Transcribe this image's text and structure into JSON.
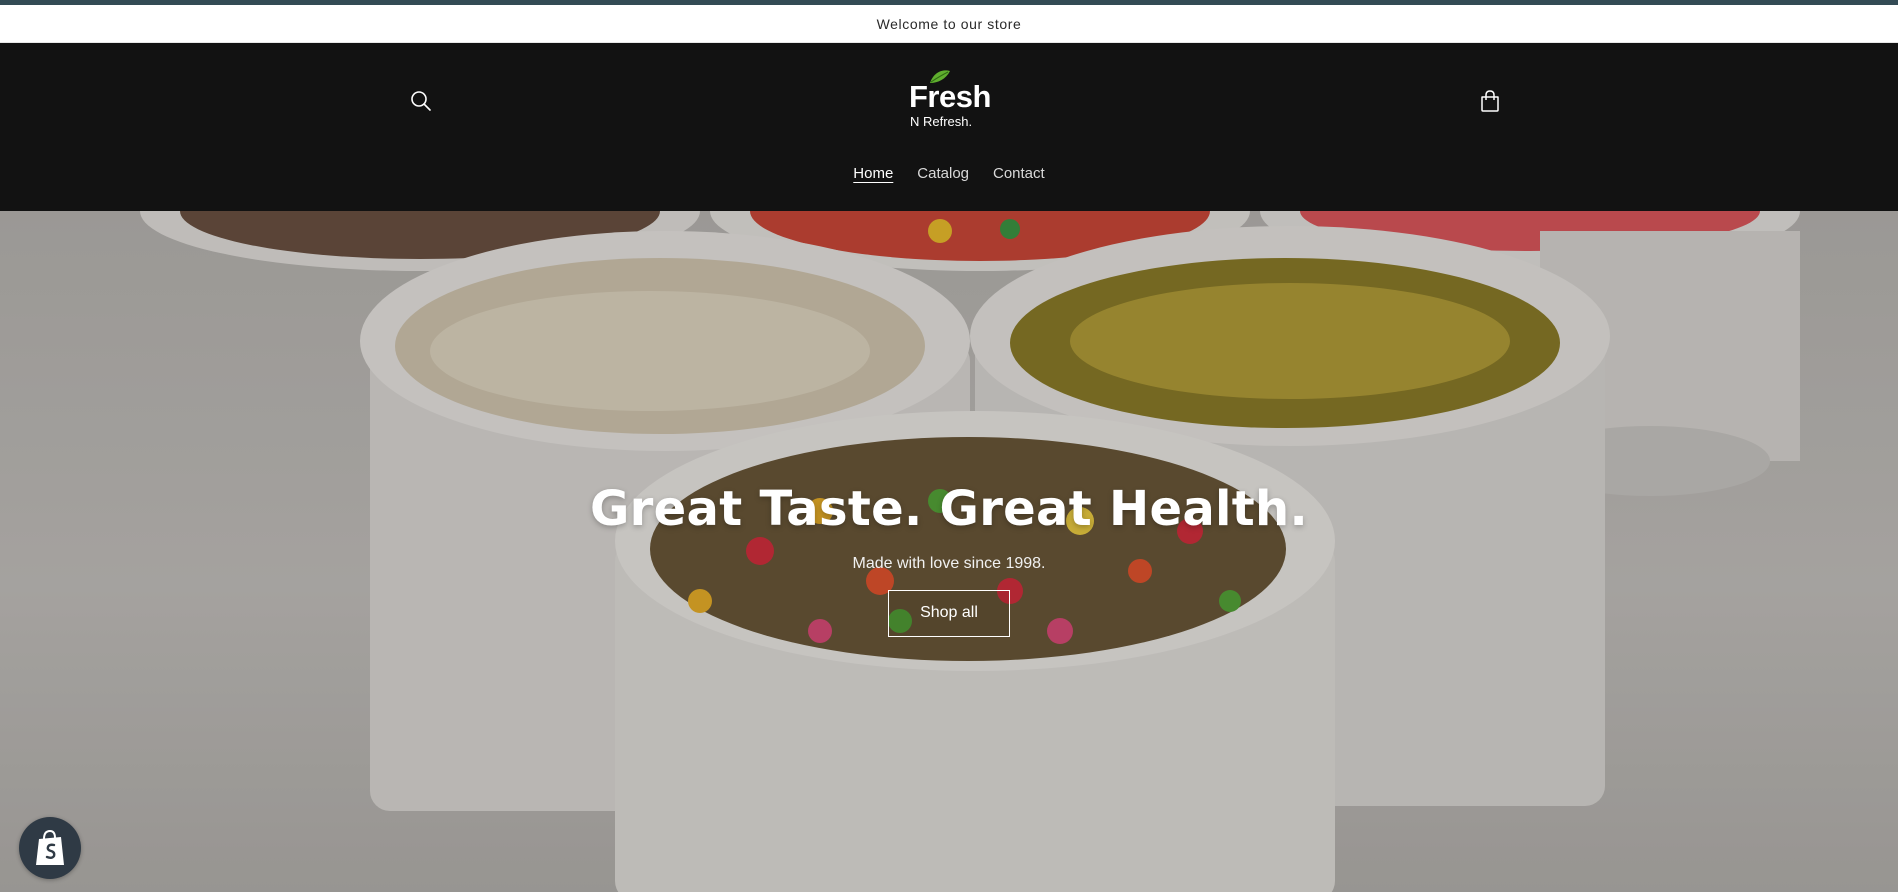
{
  "announcement": {
    "text": "Welcome to our store"
  },
  "header": {
    "logo": {
      "word": "Fresh",
      "tagline": "N Refresh."
    },
    "icons": {
      "search": "search-icon",
      "cart": "cart-icon"
    },
    "nav": [
      {
        "label": "Home",
        "active": true
      },
      {
        "label": "Catalog",
        "active": false
      },
      {
        "label": "Contact",
        "active": false
      }
    ]
  },
  "hero": {
    "title": "Great Taste. Great Health.",
    "subtitle": "Made with love since 1998.",
    "button_label": "Shop all"
  },
  "badge": {
    "icon": "shopify-bag-icon"
  },
  "colors": {
    "header_bg": "#121212",
    "top_stripe": "#334b55",
    "leaf_green": "#5fae2e",
    "badge_bg": "#2f3a45"
  }
}
